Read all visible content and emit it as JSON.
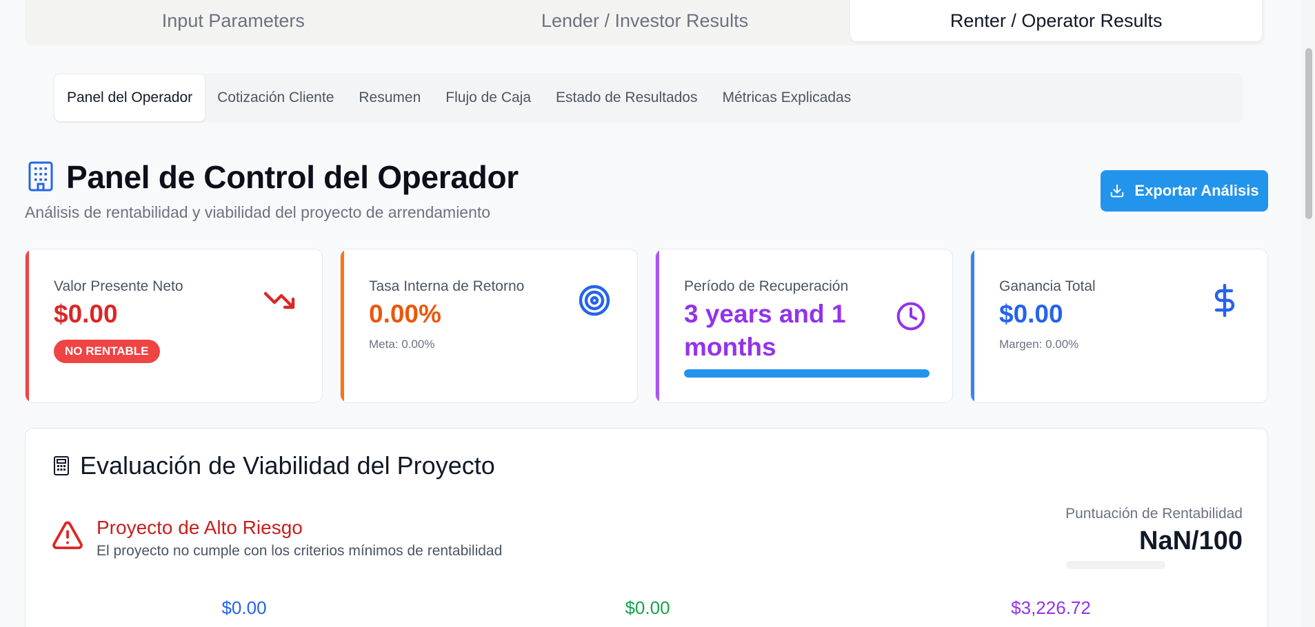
{
  "top_tabs": [
    {
      "label": "Input Parameters"
    },
    {
      "label": "Lender / Investor Results"
    },
    {
      "label": "Renter / Operator Results"
    }
  ],
  "sub_tabs": [
    {
      "label": "Panel del Operador"
    },
    {
      "label": "Cotización Cliente"
    },
    {
      "label": "Resumen"
    },
    {
      "label": "Flujo de Caja"
    },
    {
      "label": "Estado de Resultados"
    },
    {
      "label": "Métricas Explicadas"
    }
  ],
  "header": {
    "icon": "building-icon",
    "title": "Panel de Control del Operador",
    "subtitle": "Análisis de rentabilidad y viabilidad del proyecto de arrendamiento",
    "export_label": "Exportar Análisis"
  },
  "cards": {
    "npv": {
      "label": "Valor Presente Neto",
      "value": "$0.00",
      "badge": "NO RENTABLE",
      "color": "#dc2626",
      "icon": "trending-down-icon"
    },
    "irr": {
      "label": "Tasa Interna de Retorno",
      "value": "0.00%",
      "sub": "Meta: 0.00%",
      "color": "#ea580c",
      "icon": "target-icon"
    },
    "payback": {
      "label": "Período de Recuperación",
      "value": "3 years and 1 months",
      "progress": 1.0,
      "color": "#9333ea",
      "icon": "clock-icon"
    },
    "profit": {
      "label": "Ganancia Total",
      "value": "$0.00",
      "sub": "Margen: 0.00%",
      "color": "#2563eb",
      "icon": "dollar-icon"
    }
  },
  "viability": {
    "title": "Evaluación de Viabilidad del Proyecto",
    "icon": "calculator-icon",
    "risk_title": "Proyecto de Alto Riesgo",
    "risk_desc": "El proyecto no cumple con los criterios mínimos de rentabilidad",
    "risk_icon": "alert-triangle-icon",
    "score_label": "Puntuación de Rentabilidad",
    "score_value": "NaN/100",
    "stats": [
      {
        "value": "$0.00",
        "color": "#2563eb"
      },
      {
        "value": "$0.00",
        "color": "#16a34a"
      },
      {
        "value": "$3,226.72",
        "color": "#9333ea"
      }
    ]
  },
  "colors": {
    "accent": "#2294ec"
  }
}
